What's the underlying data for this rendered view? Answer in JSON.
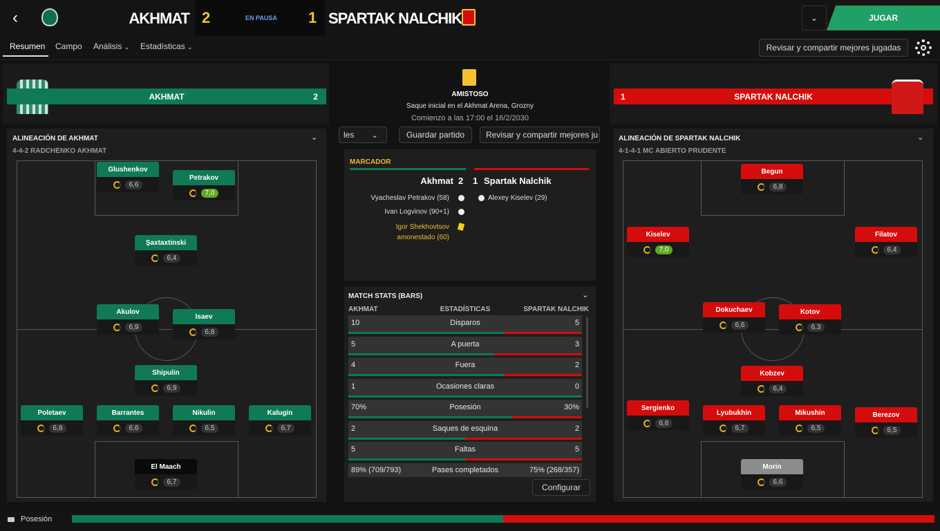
{
  "header": {
    "home_team": "AKHMAT",
    "home_score": "2",
    "status": "EN PAUSA",
    "away_score": "1",
    "away_team": "SPARTAK NALCHIK",
    "play_button": "JUGAR"
  },
  "tabs": [
    "Resumen",
    "Campo",
    "Análisis",
    "Estadísticas"
  ],
  "review_button": "Revisar y compartir mejores jugadas",
  "match": {
    "type": "AMISTOSO",
    "venue": "Saque inicial en el Akhmat Arena, Grozny",
    "time": "Comienzo a las 17:00 el 16/2/2030"
  },
  "home": {
    "banner_name": "AKHMAT",
    "banner_score": "2",
    "lineup_title": "ALINEACIÓN DE AKHMAT",
    "formation": "4-4-2 RADCHENKO AKHMAT",
    "players": [
      {
        "name": "Glushenkov",
        "rating": "6,6"
      },
      {
        "name": "Petrakov",
        "rating": "7,0"
      },
      {
        "name": "Şaxtaxtinski",
        "rating": "6,4"
      },
      {
        "name": "Akulov",
        "rating": "6,9"
      },
      {
        "name": "Isaev",
        "rating": "6,8"
      },
      {
        "name": "Shipulin",
        "rating": "6,9"
      },
      {
        "name": "Poletaev",
        "rating": "6,8"
      },
      {
        "name": "Barrantes",
        "rating": "6,6"
      },
      {
        "name": "Nikulin",
        "rating": "6,5"
      },
      {
        "name": "Kalugin",
        "rating": "6,7"
      },
      {
        "name": "El Maach",
        "rating": "6,7"
      }
    ]
  },
  "away": {
    "banner_name": "SPARTAK NALCHIK",
    "banner_score": "1",
    "lineup_title": "ALINEACIÓN DE SPARTAK NALCHIK",
    "formation": "4-1-4-1 MC ABIERTO PRUDENTE",
    "players": [
      {
        "name": "Begun",
        "rating": "6,8"
      },
      {
        "name": "Kiselev",
        "rating": "7,0"
      },
      {
        "name": "Filatov",
        "rating": "6,4"
      },
      {
        "name": "Dokuchaev",
        "rating": "6,6"
      },
      {
        "name": "Kotov",
        "rating": "6,3"
      },
      {
        "name": "Kobzev",
        "rating": "6,4"
      },
      {
        "name": "Sergienko",
        "rating": "6,6"
      },
      {
        "name": "Lyubukhin",
        "rating": "6,7"
      },
      {
        "name": "Mikushin",
        "rating": "6,5"
      },
      {
        "name": "Berezov",
        "rating": "6,5"
      },
      {
        "name": "Morin",
        "rating": "6,6"
      }
    ]
  },
  "middle_controls": {
    "partial_select": "les",
    "save_button": "Guardar partido",
    "review_partial": "Revisar y compartir mejores ju"
  },
  "scoreboard": {
    "title": "MARCADOR",
    "home": "Akhmat",
    "home_goals": "2",
    "away_goals": "1",
    "away": "Spartak Nalchik",
    "home_events": [
      "Vyacheslav Petrakov (58)",
      "Ivan Logvinov (90+1)"
    ],
    "booking_line1": "Igor Shekhovtsov",
    "booking_line2": "amonestado (60)",
    "away_events": [
      "Alexey Kiselev (29)"
    ]
  },
  "stats": {
    "title": "MATCH STATS (BARS)",
    "col_home": "AKHMAT",
    "col_mid": "ESTADÍSTICAS",
    "col_away": "SPARTAK NALCHIK",
    "rows": [
      {
        "home": "10",
        "label": "Disparos",
        "away": "5",
        "share": 0.667
      },
      {
        "home": "5",
        "label": "A puerta",
        "away": "3",
        "share": 0.625
      },
      {
        "home": "4",
        "label": "Fuera",
        "away": "2",
        "share": 0.667
      },
      {
        "home": "1",
        "label": "Ocasiones claras",
        "away": "0",
        "share": 1.0
      },
      {
        "home": "70%",
        "label": "Posesión",
        "away": "30%",
        "share": 0.7
      },
      {
        "home": "2",
        "label": "Saques de esquina",
        "away": "2",
        "share": 0.5
      },
      {
        "home": "5",
        "label": "Faltas",
        "away": "5",
        "share": 0.5
      }
    ],
    "last_row": {
      "home": "89% (709/793)",
      "label": "Pases completados",
      "away": "75% (268/357)"
    },
    "configure": "Configurar"
  },
  "footer": {
    "label": "Posesión",
    "home_share": 0.5
  },
  "colors": {
    "home": "#0f7a55",
    "away": "#d50c0c",
    "accent": "#1fa064"
  }
}
